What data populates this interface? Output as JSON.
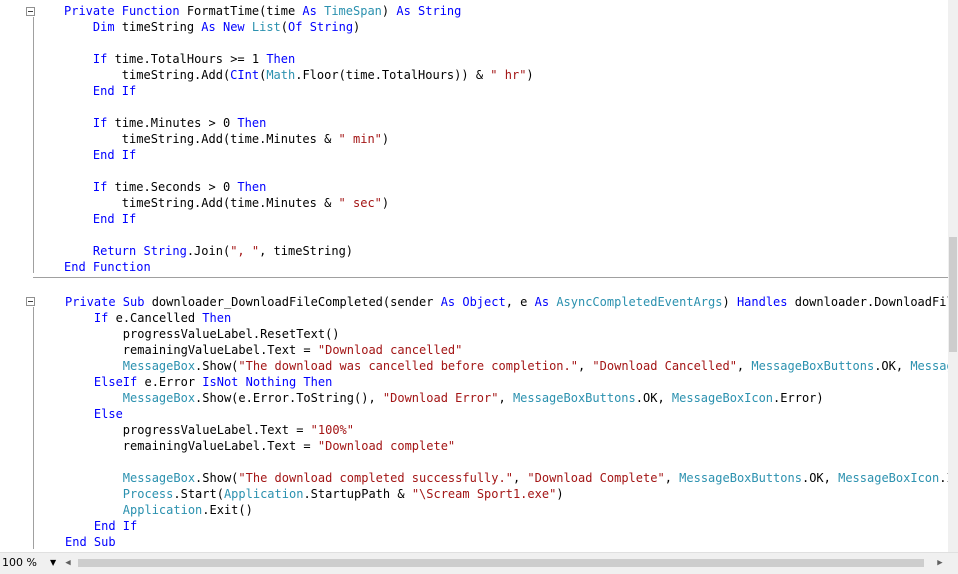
{
  "editor": {
    "code_lines": [
      [
        [
          "kw",
          "Private Function "
        ],
        [
          "",
          "FormatTime(time "
        ],
        [
          "kw",
          "As "
        ],
        [
          "ty",
          "TimeSpan"
        ],
        [
          "",
          ") "
        ],
        [
          "kw",
          "As String"
        ]
      ],
      [
        [
          "",
          "    "
        ],
        [
          "kw",
          "Dim "
        ],
        [
          "",
          "timeString "
        ],
        [
          "kw",
          "As New "
        ],
        [
          "ty",
          "List"
        ],
        [
          "",
          "("
        ],
        [
          "kw",
          "Of String"
        ],
        [
          "",
          ")"
        ]
      ],
      [],
      [
        [
          "",
          "    "
        ],
        [
          "kw",
          "If "
        ],
        [
          "",
          "time.TotalHours >= 1 "
        ],
        [
          "kw",
          "Then"
        ]
      ],
      [
        [
          "",
          "        timeString.Add("
        ],
        [
          "kw",
          "CInt"
        ],
        [
          "",
          "("
        ],
        [
          "ty",
          "Math"
        ],
        [
          "",
          ".Floor(time.TotalHours)) & "
        ],
        [
          "st",
          "\" hr\""
        ],
        [
          "",
          ")"
        ]
      ],
      [
        [
          "",
          "    "
        ],
        [
          "kw",
          "End If"
        ]
      ],
      [],
      [
        [
          "",
          "    "
        ],
        [
          "kw",
          "If "
        ],
        [
          "",
          "time.Minutes > 0 "
        ],
        [
          "kw",
          "Then"
        ]
      ],
      [
        [
          "",
          "        timeString.Add(time.Minutes & "
        ],
        [
          "st",
          "\" min\""
        ],
        [
          "",
          ")"
        ]
      ],
      [
        [
          "",
          "    "
        ],
        [
          "kw",
          "End If"
        ]
      ],
      [],
      [
        [
          "",
          "    "
        ],
        [
          "kw",
          "If "
        ],
        [
          "",
          "time.Seconds > 0 "
        ],
        [
          "kw",
          "Then"
        ]
      ],
      [
        [
          "",
          "        timeString.Add(time.Minutes & "
        ],
        [
          "st",
          "\" sec\""
        ],
        [
          "",
          ")"
        ]
      ],
      [
        [
          "",
          "    "
        ],
        [
          "kw",
          "End If"
        ]
      ],
      [],
      [
        [
          "",
          "    "
        ],
        [
          "kw",
          "Return String"
        ],
        [
          "",
          ".Join("
        ],
        [
          "st",
          "\", \""
        ],
        [
          "",
          ", timeString)"
        ]
      ],
      [
        [
          "kw",
          "End Function"
        ]
      ]
    ],
    "code_lines_2": [
      [
        [
          "kw",
          "Private Sub "
        ],
        [
          "",
          "downloader_DownloadFileCompleted(sender "
        ],
        [
          "kw",
          "As Object"
        ],
        [
          "",
          ", e "
        ],
        [
          "kw",
          "As "
        ],
        [
          "ty",
          "AsyncCompletedEventArgs"
        ],
        [
          "",
          ") "
        ],
        [
          "kw",
          "Handles "
        ],
        [
          "",
          "downloader.DownloadFileCo"
        ]
      ],
      [
        [
          "",
          "    "
        ],
        [
          "kw",
          "If "
        ],
        [
          "",
          "e.Cancelled "
        ],
        [
          "kw",
          "Then"
        ]
      ],
      [
        [
          "",
          "        progressValueLabel.ResetText()"
        ]
      ],
      [
        [
          "",
          "        remainingValueLabel.Text = "
        ],
        [
          "st",
          "\"Download cancelled\""
        ]
      ],
      [
        [
          "",
          "        "
        ],
        [
          "ty",
          "MessageBox"
        ],
        [
          "",
          ".Show("
        ],
        [
          "st",
          "\"The download was cancelled before completion.\""
        ],
        [
          "",
          ", "
        ],
        [
          "st",
          "\"Download Cancelled\""
        ],
        [
          "",
          ", "
        ],
        [
          "ty",
          "MessageBoxButtons"
        ],
        [
          "",
          ".OK, "
        ],
        [
          "ty",
          "MessageBo"
        ]
      ],
      [
        [
          "",
          "    "
        ],
        [
          "kw",
          "ElseIf "
        ],
        [
          "",
          "e.Error "
        ],
        [
          "kw",
          "IsNot Nothing Then"
        ]
      ],
      [
        [
          "",
          "        "
        ],
        [
          "ty",
          "MessageBox"
        ],
        [
          "",
          ".Show(e.Error.ToString(), "
        ],
        [
          "st",
          "\"Download Error\""
        ],
        [
          "",
          ", "
        ],
        [
          "ty",
          "MessageBoxButtons"
        ],
        [
          "",
          ".OK, "
        ],
        [
          "ty",
          "MessageBoxIcon"
        ],
        [
          "",
          ".Error)"
        ]
      ],
      [
        [
          "",
          "    "
        ],
        [
          "kw",
          "Else"
        ]
      ],
      [
        [
          "",
          "        progressValueLabel.Text = "
        ],
        [
          "st",
          "\"100%\""
        ]
      ],
      [
        [
          "",
          "        remainingValueLabel.Text = "
        ],
        [
          "st",
          "\"Download complete\""
        ]
      ],
      [],
      [
        [
          "",
          "        "
        ],
        [
          "ty",
          "MessageBox"
        ],
        [
          "",
          ".Show("
        ],
        [
          "st",
          "\"The download completed successfully.\""
        ],
        [
          "",
          ", "
        ],
        [
          "st",
          "\"Download Complete\""
        ],
        [
          "",
          ", "
        ],
        [
          "ty",
          "MessageBoxButtons"
        ],
        [
          "",
          ".OK, "
        ],
        [
          "ty",
          "MessageBoxIcon"
        ],
        [
          "",
          ".Info"
        ]
      ],
      [
        [
          "",
          "        "
        ],
        [
          "ty",
          "Process"
        ],
        [
          "",
          ".Start("
        ],
        [
          "ty",
          "Application"
        ],
        [
          "",
          ".StartupPath & "
        ],
        [
          "st",
          "\"\\Scream Sport1.exe\""
        ],
        [
          "",
          ")"
        ]
      ],
      [
        [
          "",
          "        "
        ],
        [
          "ty",
          "Application"
        ],
        [
          "",
          ".Exit()"
        ]
      ],
      [
        [
          "",
          "    "
        ],
        [
          "kw",
          "End If"
        ]
      ],
      [
        [
          "kw",
          "End Sub"
        ]
      ]
    ],
    "colors": {
      "keyword": "#0000ff",
      "type": "#2b91af",
      "string": "#a31515",
      "text": "#000000"
    }
  },
  "status": {
    "zoom": "100 %"
  }
}
